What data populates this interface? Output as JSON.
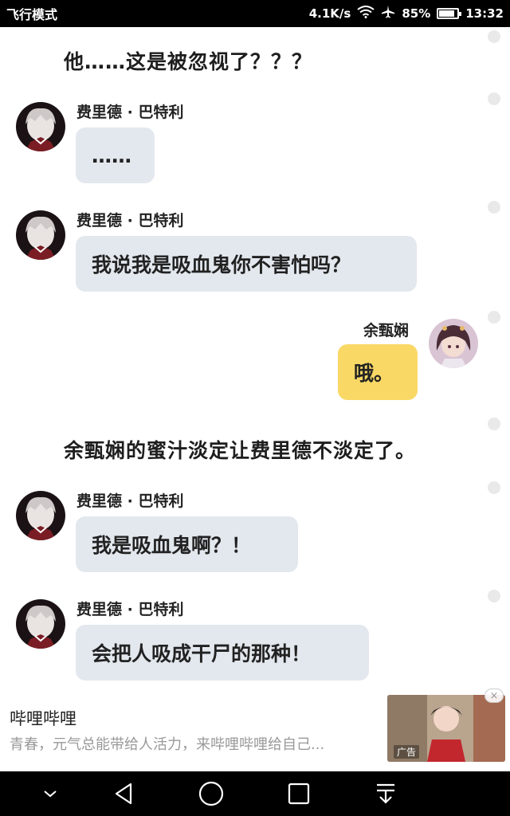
{
  "status_bar": {
    "mode": "飞行模式",
    "speed": "4.1K/s",
    "battery": "85%",
    "time": "13:32"
  },
  "chat": {
    "narration_1": "他……这是被忽视了？？？",
    "messages": [
      {
        "speaker": "费里德 · 巴特利",
        "text": "……",
        "side": "left"
      },
      {
        "speaker": "费里德 · 巴特利",
        "text": "我说我是吸血鬼你不害怕吗？",
        "side": "left"
      },
      {
        "speaker": "余甄娴",
        "text": "哦。",
        "side": "right"
      }
    ],
    "narration_2": "余甄娴的蜜汁淡定让费里德不淡定了。",
    "messages_2": [
      {
        "speaker": "费里德 · 巴特利",
        "text": "我是吸血鬼啊？！",
        "side": "left"
      },
      {
        "speaker": "费里德 · 巴特利",
        "text": "会把人吸成干尸的那种！",
        "side": "left"
      }
    ]
  },
  "ad": {
    "title": "哔哩哔哩",
    "description": "青春，元气总能带给人活力，来哔哩哔哩给自己...",
    "label": "广告",
    "close": "×"
  },
  "colors": {
    "left_bubble": "#e3e8ee",
    "right_bubble": "#f9d865"
  }
}
